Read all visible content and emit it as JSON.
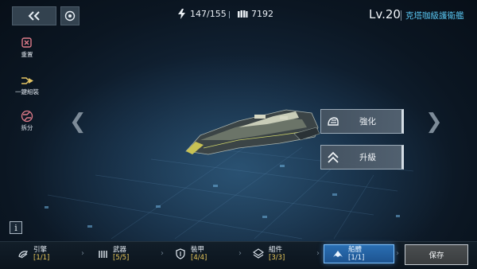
{
  "header": {
    "energy_value": "147/155",
    "currency_value": "7192",
    "level": "Lv.20",
    "ship_name": "克塔咖級護衛艦"
  },
  "side_tools": [
    {
      "label": "重置",
      "icon": "reset-icon"
    },
    {
      "label": "一鍵組裝",
      "icon": "auto-assemble-icon"
    },
    {
      "label": "拆分",
      "icon": "disassemble-icon"
    }
  ],
  "actions": {
    "enhance_label": "強化",
    "upgrade_label": "升級"
  },
  "info_label": "i",
  "tabs": [
    {
      "label": "引擎",
      "count": "[1/1]",
      "icon": "engine-icon"
    },
    {
      "label": "武器",
      "count": "[5/5]",
      "icon": "weapon-icon"
    },
    {
      "label": "裝甲",
      "count": "[4/4]",
      "icon": "armor-icon"
    },
    {
      "label": "組件",
      "count": "[3/3]",
      "icon": "component-icon"
    },
    {
      "label": "船體",
      "count": "[1/1]",
      "icon": "hull-icon",
      "active": true
    }
  ],
  "save_label": "保存",
  "colors": {
    "accent": "#58c3ee",
    "count_text": "#e9c95a",
    "active_tab": "#2a6fb3"
  }
}
